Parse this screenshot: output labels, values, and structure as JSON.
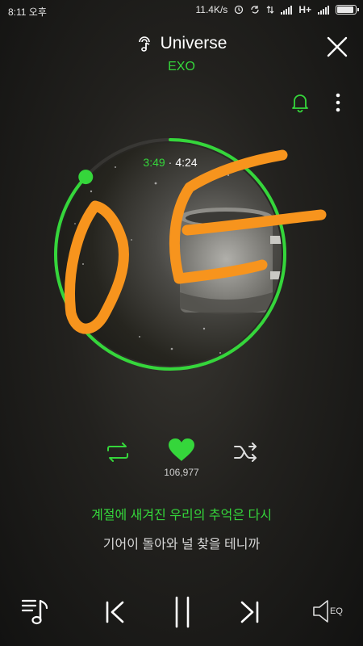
{
  "status_bar": {
    "time": "8:11 오후",
    "net_speed": "11.4K/s",
    "network": "H+"
  },
  "header": {
    "song_title": "Universe",
    "artist": "EXO"
  },
  "player": {
    "current_time": "3:49",
    "total_time": "4:24",
    "progress": 0.868,
    "like_count": "106,977"
  },
  "lyrics": {
    "current_line": "계절에 새겨진 우리의 추억은 다시",
    "next_line": "기어이 돌아와 널 찾을 테니까"
  },
  "bottom_bar": {
    "eq_label": "EQ"
  },
  "colors": {
    "accent": "#35d63b",
    "overlay_scribble": "#f7941d"
  }
}
